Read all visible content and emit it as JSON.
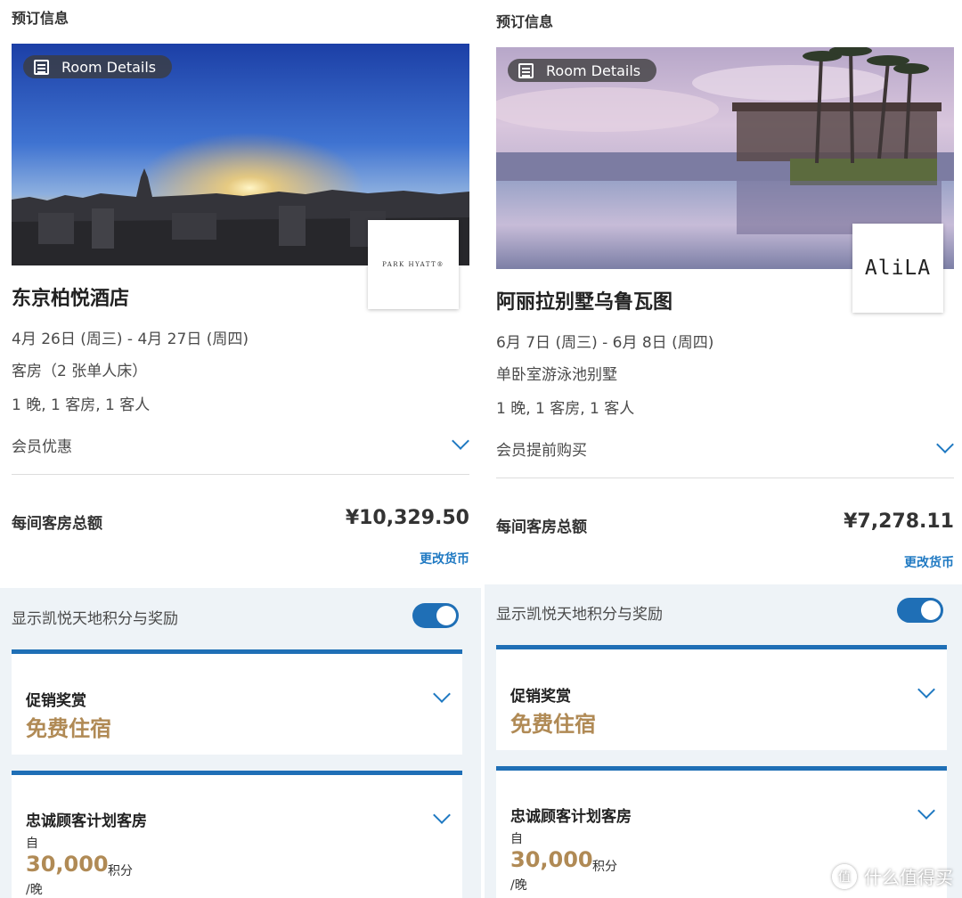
{
  "panels": [
    {
      "section_title": "预订信息",
      "room_details_label": "Room Details",
      "logo_text": "PARK HYATT®",
      "hotel_name": "东京柏悦酒店",
      "dates": "4月 26日 (周三) - 4月 27日 (周四)",
      "room_type": "客房（2 张单人床）",
      "occupancy": "1 晚, 1 客房, 1 客人",
      "member_rate": "会员优惠",
      "total_label": "每间客房总额",
      "total_value": "¥10,329.50",
      "change_currency": "更改货币",
      "toggle_label": "显示凯悦天地积分与奖励",
      "toggle_on": true,
      "promo_title": "促销奖赏",
      "promo_value": "免费住宿",
      "loyalty_title": "忠诚顾客计划客房",
      "loyalty_from": "自",
      "loyalty_points": "30,000",
      "loyalty_points_unit": "积分",
      "loyalty_per": "/晚"
    },
    {
      "section_title": "预订信息",
      "room_details_label": "Room Details",
      "logo_text": "AliLA",
      "hotel_name": "阿丽拉别墅乌鲁瓦图",
      "dates": "6月 7日 (周三) - 6月 8日 (周四)",
      "room_type": "单卧室游泳池别墅",
      "occupancy": "1 晚, 1 客房, 1 客人",
      "member_rate": "会员提前购买",
      "total_label": "每间客房总额",
      "total_value": "¥7,278.11",
      "change_currency": "更改货币",
      "toggle_label": "显示凯悦天地积分与奖励",
      "toggle_on": true,
      "promo_title": "促销奖赏",
      "promo_value": "免费住宿",
      "loyalty_title": "忠诚顾客计划客房",
      "loyalty_from": "自",
      "loyalty_points": "30,000",
      "loyalty_points_unit": "积分",
      "loyalty_per": "/晚"
    }
  ],
  "watermark": {
    "icon": "值",
    "text": "什么值得买"
  },
  "colors": {
    "accent": "#1f6fb6",
    "link": "#1f79c2",
    "gold": "#b08a55",
    "panel_bg": "#eef3f7"
  }
}
